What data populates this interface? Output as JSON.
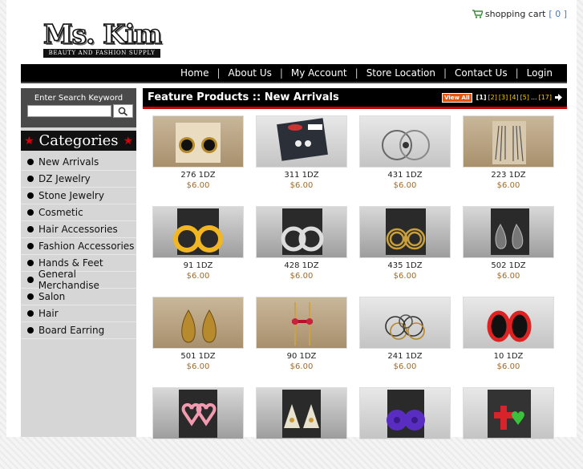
{
  "header": {
    "cart_label": "shopping cart",
    "cart_count": "[ 0 ]",
    "logo_text": "Ms. Kim",
    "logo_tagline": "Beauty and Fashion Supply"
  },
  "nav": [
    "Home",
    "About Us",
    "My Account",
    "Store Location",
    "Contact Us",
    "Login"
  ],
  "sidebar": {
    "search_title": "Enter Search Keyword",
    "search_value": "",
    "categories_title": "Categories",
    "categories": [
      "New Arrivals",
      "DZ Jewelry",
      "Stone Jewelry",
      "Cosmetic",
      "Hair Accessories",
      "Fashion Accessories",
      "Hands & Feet",
      "General Merchandise",
      "Salon",
      "Hair",
      "Board Earring"
    ]
  },
  "main": {
    "feature_title": "Feature Products :: New Arrivals",
    "view_all": "View All",
    "pages": [
      "[1]",
      "[2]",
      "[3]",
      "[4]",
      "[5]",
      "...",
      "[17]"
    ]
  },
  "products": [
    {
      "name": "276 1DZ",
      "price": "$6.00",
      "icon": "black-stud-earring-icon"
    },
    {
      "name": "311 1DZ",
      "price": "$6.00",
      "icon": "crystal-stud-card-icon"
    },
    {
      "name": "431 1DZ",
      "price": "$6.00",
      "icon": "clear-hoop-earring-icon"
    },
    {
      "name": "223 1DZ",
      "price": "$6.00",
      "icon": "chain-fringe-earring-icon"
    },
    {
      "name": "91 1DZ",
      "price": "$6.00",
      "icon": "yellow-hoop-earring-icon"
    },
    {
      "name": "428 1DZ",
      "price": "$6.00",
      "icon": "silver-hoop-earring-icon"
    },
    {
      "name": "435 1DZ",
      "price": "$6.00",
      "icon": "gold-triple-hoop-icon"
    },
    {
      "name": "502 1DZ",
      "price": "$6.00",
      "icon": "black-drop-earring-icon"
    },
    {
      "name": "501 1DZ",
      "price": "$6.00",
      "icon": "gold-teardrop-earring-icon"
    },
    {
      "name": "90 1DZ",
      "price": "$6.00",
      "icon": "red-bar-earring-icon"
    },
    {
      "name": "241 1DZ",
      "price": "$6.00",
      "icon": "multi-ring-earring-icon"
    },
    {
      "name": "10 1DZ",
      "price": "$6.00",
      "icon": "red-oval-earring-icon"
    },
    {
      "name": "",
      "price": "",
      "icon": "pink-heart-earring-icon"
    },
    {
      "name": "",
      "price": "",
      "icon": "feather-fan-earring-icon"
    },
    {
      "name": "",
      "price": "",
      "icon": "purple-flower-earring-icon"
    },
    {
      "name": "",
      "price": "",
      "icon": "red-cross-earring-icon"
    }
  ],
  "colors": {
    "accent_red": "#cc0000",
    "price": "#a16a2a",
    "view_all": "#e4540f"
  }
}
